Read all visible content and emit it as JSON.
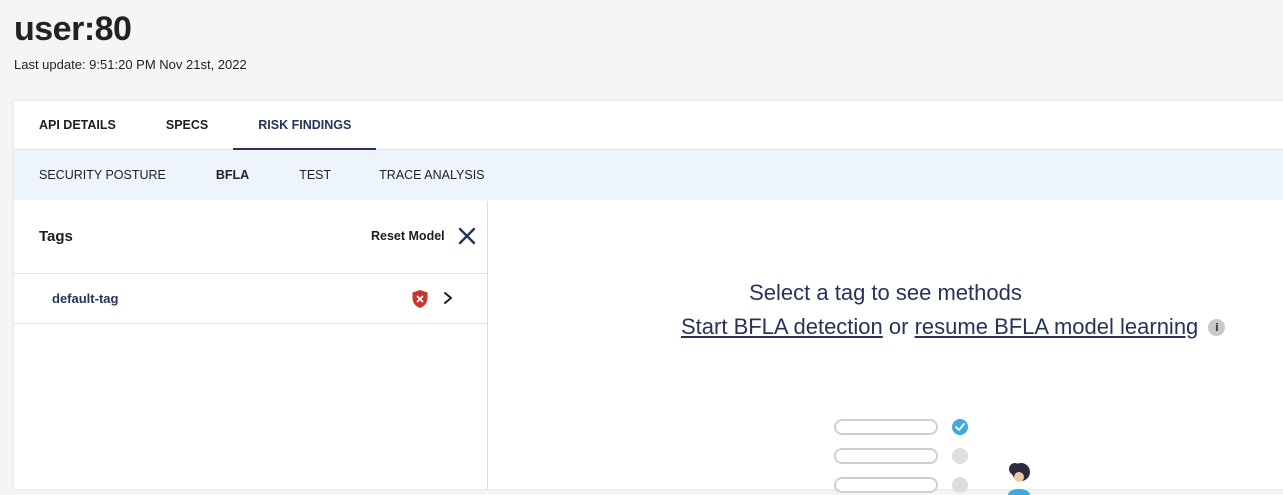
{
  "header": {
    "title": "user:80",
    "last_update": "Last update: 9:51:20 PM Nov 21st, 2022"
  },
  "main_tabs": [
    {
      "label": "API DETAILS",
      "active": false
    },
    {
      "label": "SPECS",
      "active": false
    },
    {
      "label": "RISK FINDINGS",
      "active": true
    }
  ],
  "sub_tabs": [
    {
      "label": "SECURITY POSTURE",
      "active": false
    },
    {
      "label": "BFLA",
      "active": true
    },
    {
      "label": "TEST",
      "active": false
    },
    {
      "label": "TRACE ANALYSIS",
      "active": false
    }
  ],
  "tags_panel": {
    "title": "Tags",
    "reset_label": "Reset Model",
    "close_icon": "close-icon",
    "tags": [
      {
        "name": "default-tag",
        "status_icon": "shield-x-icon",
        "status_color": "#c9352b"
      }
    ]
  },
  "methods_panel": {
    "empty_title": "Select a tag to see methods",
    "start_link": "Start BFLA detection",
    "or_text": "or",
    "resume_link": "resume BFLA model learning",
    "info_icon": "i"
  },
  "colors": {
    "accent": "#27335a",
    "subtab_bg": "#eef4fb",
    "illustration_check": "#3fa9e0",
    "danger": "#c9352b"
  }
}
